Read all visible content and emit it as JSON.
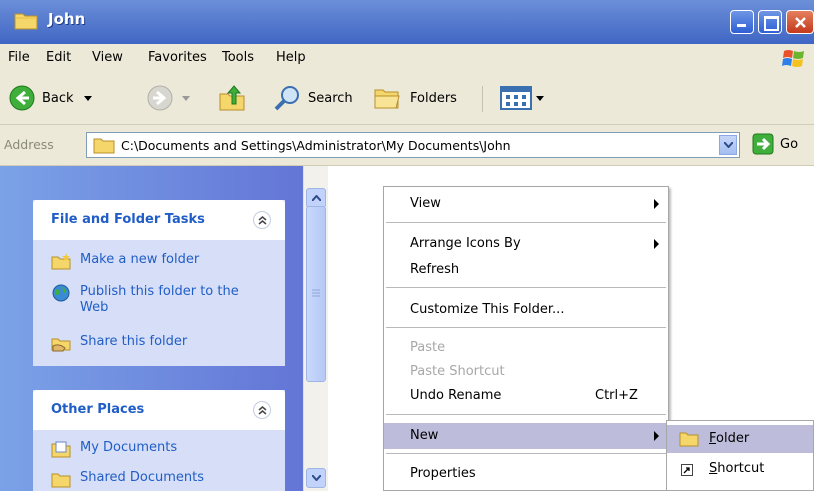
{
  "window": {
    "title": "John"
  },
  "menubar": {
    "items": [
      "File",
      "Edit",
      "View",
      "Favorites",
      "Tools",
      "Help"
    ]
  },
  "toolbar": {
    "back_label": "Back",
    "search_label": "Search",
    "folders_label": "Folders"
  },
  "address": {
    "label": "Address",
    "path": "C:\\Documents and Settings\\Administrator\\My Documents\\John",
    "go_label": "Go"
  },
  "file_tasks": {
    "title": "File and Folder Tasks",
    "items": [
      "Make a new folder",
      "Publish this folder to the Web",
      "Share this folder"
    ]
  },
  "other_places": {
    "title": "Other Places",
    "items": [
      "My Documents",
      "Shared Documents"
    ]
  },
  "context_menu": {
    "view": "View",
    "arrange": "Arrange Icons By",
    "refresh": "Refresh",
    "customize": "Customize This Folder...",
    "paste": "Paste",
    "paste_shortcut": "Paste Shortcut",
    "undo": "Undo Rename",
    "undo_shortcut": "Ctrl+Z",
    "new": "New",
    "properties": "Properties"
  },
  "submenu": {
    "folder_accel": "F",
    "folder_rest": "older",
    "shortcut_accel": "S",
    "shortcut_rest": "hortcut"
  },
  "colors": {
    "title_bar": "#3f66c4",
    "task_link": "#215dc6",
    "highlight": "#bdbddb"
  }
}
